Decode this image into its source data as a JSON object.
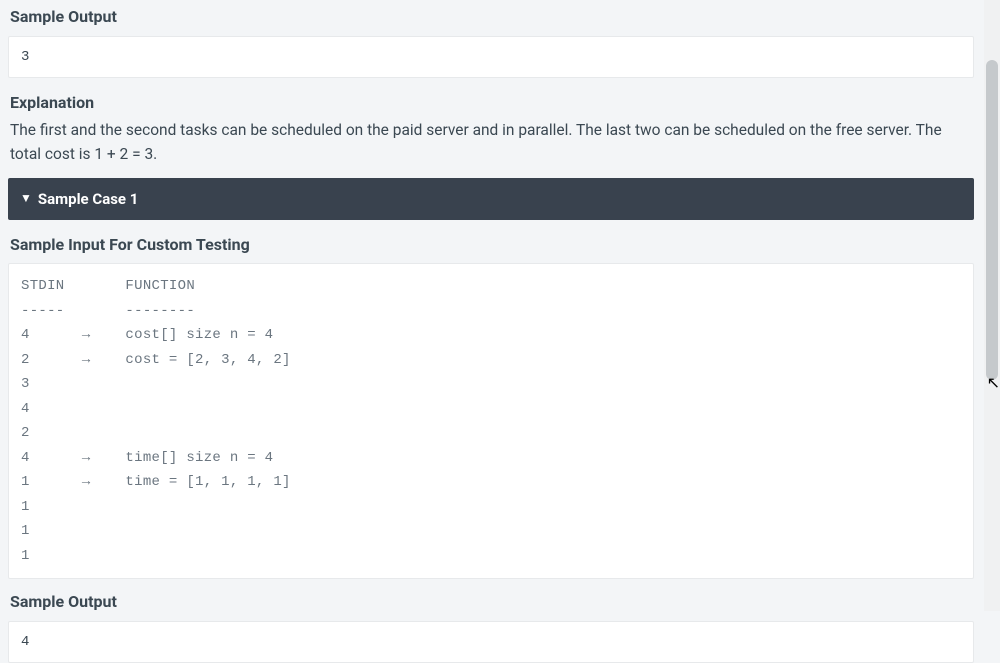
{
  "block0": {
    "sample_output_header": "Sample Output",
    "sample_output_value": "3",
    "explanation_header": "Explanation",
    "explanation_text": "The first and the second tasks can be scheduled on the paid server and in parallel. The last two can be scheduled on the free server. The total cost is 1 + 2 = 3."
  },
  "case1": {
    "bar_label": "Sample Case 1",
    "input_header": "Sample Input For Custom Testing",
    "code_block": "STDIN       FUNCTION\n-----       --------\n4      →    cost[] size n = 4\n2      →    cost = [2, 3, 4, 2]\n3\n4\n2\n4      →    time[] size n = 4\n1      →    time = [1, 1, 1, 1]\n1\n1\n1",
    "sample_output_header": "Sample Output",
    "sample_output_value": "4"
  }
}
